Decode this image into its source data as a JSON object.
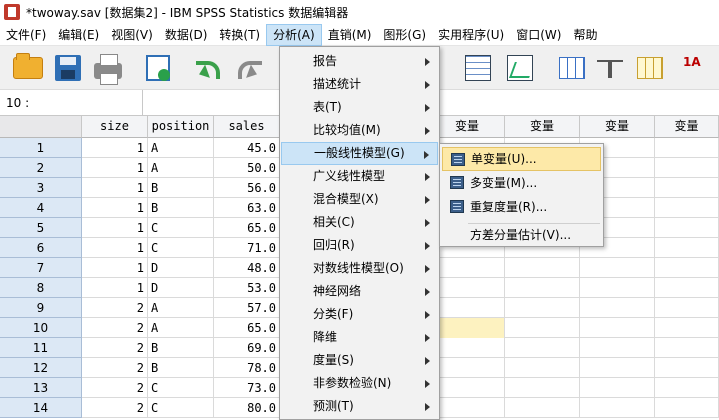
{
  "window": {
    "title": "*twoway.sav [数据集2] - IBM SPSS Statistics 数据编辑器"
  },
  "menubar": [
    {
      "label": "文件(F)",
      "x": 0
    },
    {
      "label": "编辑(E)"
    },
    {
      "label": "视图(V)"
    },
    {
      "label": "数据(D)"
    },
    {
      "label": "转换(T)"
    },
    {
      "label": "分析(A)",
      "active": true
    },
    {
      "label": "直销(M)"
    },
    {
      "label": "图形(G)"
    },
    {
      "label": "实用程序(U)"
    },
    {
      "label": "窗口(W)"
    },
    {
      "label": "帮助"
    }
  ],
  "toolbar_icons": [
    "open-folder-icon",
    "save-floppy-icon",
    "print-icon",
    "recall-dialog-icon",
    "undo-icon",
    "redo-icon",
    "goto-case-icon",
    "variables-icon",
    "find-icon",
    "split-file-icon",
    "weight-cases-icon",
    "value-labels-icon"
  ],
  "cell_ref": "10 :",
  "columns": [
    "size",
    "position",
    "sales"
  ],
  "empty_var_label": "变量",
  "rows": [
    {
      "n": "1",
      "size": "1",
      "position": "A",
      "sales": "45.0"
    },
    {
      "n": "2",
      "size": "1",
      "position": "A",
      "sales": "50.0"
    },
    {
      "n": "3",
      "size": "1",
      "position": "B",
      "sales": "56.0"
    },
    {
      "n": "4",
      "size": "1",
      "position": "B",
      "sales": "63.0"
    },
    {
      "n": "5",
      "size": "1",
      "position": "C",
      "sales": "65.0"
    },
    {
      "n": "6",
      "size": "1",
      "position": "C",
      "sales": "71.0"
    },
    {
      "n": "7",
      "size": "1",
      "position": "D",
      "sales": "48.0"
    },
    {
      "n": "8",
      "size": "1",
      "position": "D",
      "sales": "53.0"
    },
    {
      "n": "9",
      "size": "2",
      "position": "A",
      "sales": "57.0"
    },
    {
      "n": "10",
      "size": "2",
      "position": "A",
      "sales": "65.0"
    },
    {
      "n": "11",
      "size": "2",
      "position": "B",
      "sales": "69.0"
    },
    {
      "n": "12",
      "size": "2",
      "position": "B",
      "sales": "78.0"
    },
    {
      "n": "13",
      "size": "2",
      "position": "C",
      "sales": "73.0"
    },
    {
      "n": "14",
      "size": "2",
      "position": "C",
      "sales": "80.0"
    }
  ],
  "analyze_menu": [
    {
      "label": "报告"
    },
    {
      "label": "描述统计"
    },
    {
      "label": "表(T)"
    },
    {
      "label": "比较均值(M)"
    },
    {
      "label": "一般线性模型(G)",
      "highlighted": true
    },
    {
      "label": "广义线性模型"
    },
    {
      "label": "混合模型(X)"
    },
    {
      "label": "相关(C)"
    },
    {
      "label": "回归(R)"
    },
    {
      "label": "对数线性模型(O)"
    },
    {
      "label": "神经网络"
    },
    {
      "label": "分类(F)"
    },
    {
      "label": "降维"
    },
    {
      "label": "度量(S)"
    },
    {
      "label": "非参数检验(N)"
    },
    {
      "label": "预测(T)"
    }
  ],
  "glm_submenu": [
    {
      "label": "单变量(U)...",
      "highlighted": true
    },
    {
      "label": "多变量(M)..."
    },
    {
      "label": "重复度量(R)..."
    },
    {
      "label": "方差分量估计(V)..."
    }
  ]
}
